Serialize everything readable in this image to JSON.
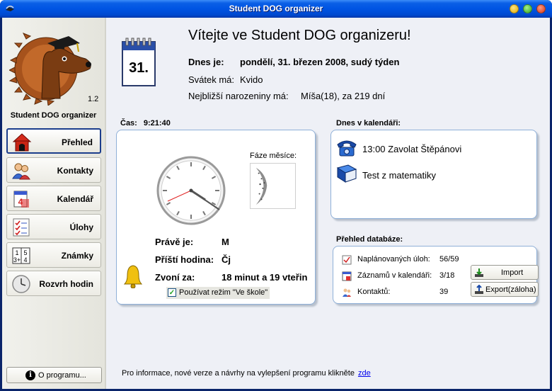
{
  "window": {
    "title": "Student DOG organizer"
  },
  "sidebar": {
    "version": "1.2",
    "app_name": "Student DOG organizer",
    "items": [
      {
        "label": "Přehled",
        "icon": "doghouse-icon"
      },
      {
        "label": "Kontakty",
        "icon": "contacts-icon"
      },
      {
        "label": "Kalendář",
        "icon": "calendar-icon"
      },
      {
        "label": "Úlohy",
        "icon": "checklist-icon"
      },
      {
        "label": "Známky",
        "icon": "grades-icon"
      },
      {
        "label": "Rozvrh hodin",
        "icon": "clock-icon"
      }
    ],
    "about_label": "O programu..."
  },
  "header": {
    "welcome": "Vítejte ve Student DOG organizeru!",
    "calendar_day": "31.",
    "today_label": "Dnes je:",
    "today_value": "pondělí, 31. březen 2008, sudý týden",
    "nameday_label": "Svátek má:",
    "nameday_value": "Kvido",
    "birthday_label": "Nejbližší narozeniny má:",
    "birthday_value": "Míša(18), za 219 dní"
  },
  "time_panel": {
    "label": "Čas:",
    "time": "9:21:40",
    "moon_label": "Fáze měsíce:",
    "now_label": "Právě je:",
    "now_value": "M",
    "next_label": "Příští hodina:",
    "next_value": "Čj",
    "bell_label": "Zvoní za:",
    "bell_value": "18 minut a 19 vteřin",
    "school_mode_label": "Používat režim \"Ve škole\"",
    "school_mode_checked": true
  },
  "calendar_panel": {
    "label": "Dnes v kalendáři:",
    "events": [
      {
        "text": "13:00 Zavolat Štěpánovi",
        "icon": "phone-icon"
      },
      {
        "text": "Test z matematiky",
        "icon": "book-icon"
      }
    ]
  },
  "db_panel": {
    "label": "Přehled databáze:",
    "rows": [
      {
        "label": "Naplánovaných úloh:",
        "value": "56/59",
        "icon": "tasks-icon"
      },
      {
        "label": "Záznamů v kalendáři:",
        "value": "3/18",
        "icon": "calendar-small-icon"
      },
      {
        "label": "Kontaktů:",
        "value": "39",
        "icon": "contacts-small-icon"
      }
    ],
    "import_label": "Import",
    "export_label": "Export(záloha)"
  },
  "footer": {
    "text": "Pro informace, nové verze a návrhy na vylepšení programu klikněte",
    "link": "zde"
  },
  "colors": {
    "titlebar": "#0054e3",
    "panel_border": "#8fb0d8",
    "main_bg": "#eef0f6",
    "sidebar_bg": "#eceae2",
    "link": "#0000ee"
  }
}
